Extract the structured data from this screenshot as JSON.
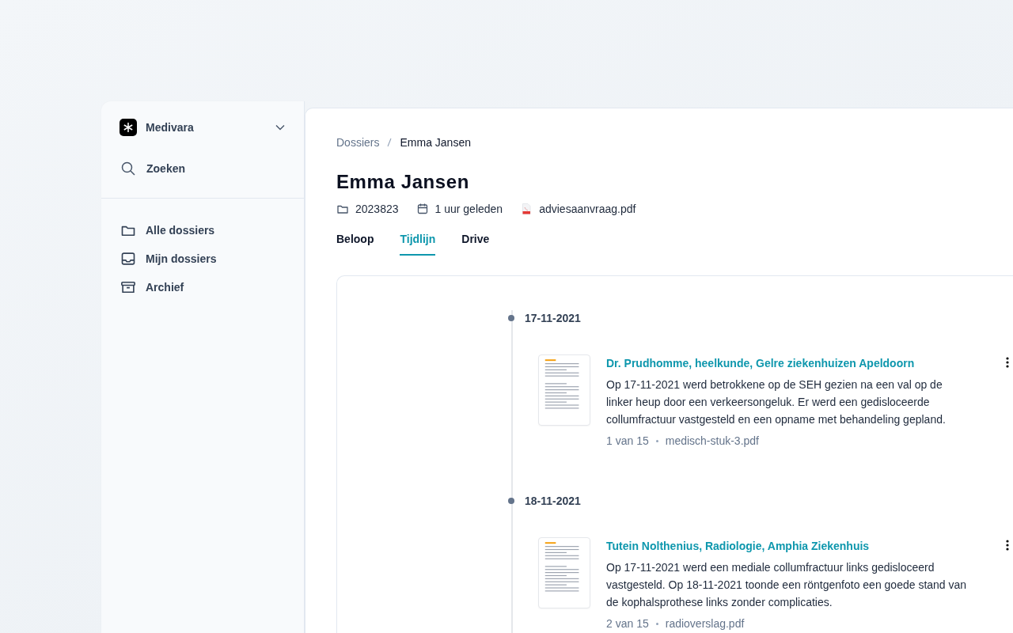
{
  "sidebar": {
    "workspace": "Medivara",
    "search": "Zoeken",
    "items": [
      {
        "label": "Alle dossiers",
        "kind": "folder",
        "selected": false
      },
      {
        "label": "Mijn dossiers",
        "kind": "inbox",
        "selected": false
      },
      {
        "label": "Archief",
        "kind": "archive",
        "selected": false
      }
    ]
  },
  "breadcrumb": [
    "Dossiers",
    "Emma Jansen"
  ],
  "title": "Emma Jansen",
  "meta": [
    {
      "kind": "folder",
      "text": "2023823"
    },
    {
      "kind": "calendar",
      "text": "1 uur geleden"
    },
    {
      "kind": "pdf",
      "text": "adviesaanvraag.pdf"
    }
  ],
  "tabs": [
    {
      "label": "Beloop",
      "selected": false
    },
    {
      "label": "Tijdlijn",
      "selected": true
    },
    {
      "label": "Drive",
      "selected": false
    }
  ],
  "timeline": [
    {
      "date": "17-11-2021",
      "title": "Dr. Prudhomme, heelkunde, Gelre ziekenhuizen Apeldoorn",
      "text": "Op 17-11-2021 werd betrokkene op de SEH gezien na een val op de linker heup door een verkeersongeluk. Er werd een gedisloceerde collumfractuur vastgesteld en een opname met behandeling gepland.",
      "page": "1 van 15",
      "file": "medisch-stuk-3.pdf"
    },
    {
      "date": "18-11-2021",
      "title": "Tutein Nolthenius, Radiologie, Amphia Ziekenhuis",
      "text": "Op 17-11-2021 werd een mediale collumfractuur links gedisloceerd vastgesteld. Op 18-11-2021 toonde een röntgenfoto een goede stand van de kophalsprothese links zonder complicaties.",
      "page": "2 van 15",
      "file": "radioverslag.pdf"
    }
  ]
}
